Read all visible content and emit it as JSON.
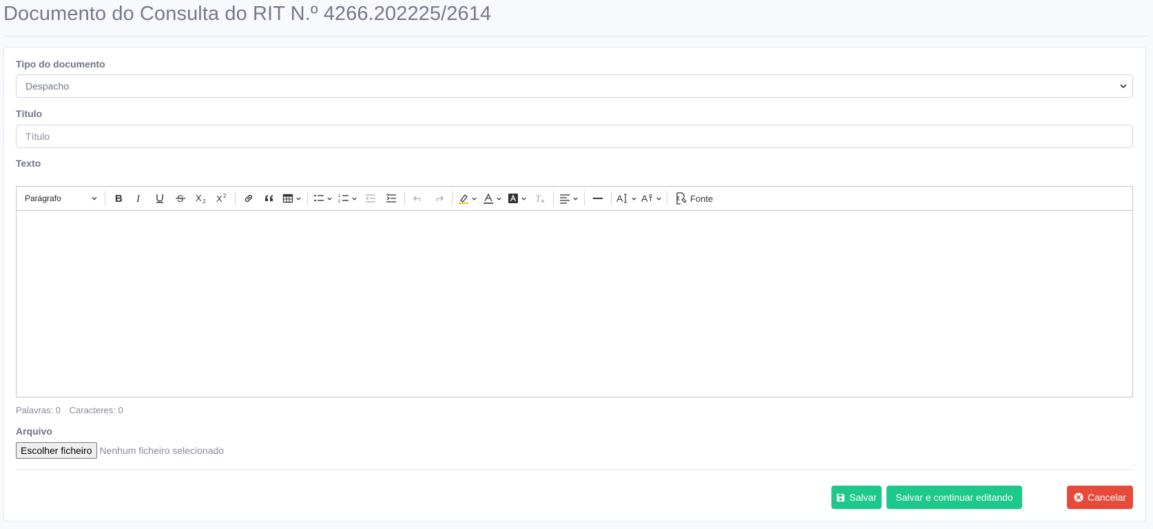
{
  "page": {
    "title": "Documento do Consulta do RIT N.º 4266.202225/2614"
  },
  "form": {
    "tipo_label": "Tipo do documento",
    "tipo_value": "Despacho",
    "titulo_label": "Título",
    "titulo_placeholder": "Título",
    "texto_label": "Texto",
    "arquivo_label": "Arquivo",
    "file_button": "Escolher ficheiro",
    "file_status": "Nenhum ficheiro selecionado"
  },
  "editor": {
    "heading_value": "Parágrafo",
    "source_label": "Fonte",
    "toolbar_icons": [
      "bold-icon",
      "italic-icon",
      "underline-icon",
      "strikethrough-icon",
      "subscript-icon",
      "superscript-icon",
      "link-icon",
      "blockquote-icon",
      "table-icon",
      "bulleted-list-icon",
      "numbered-list-icon",
      "outdent-icon",
      "indent-icon",
      "undo-icon",
      "redo-icon",
      "highlight-icon",
      "font-color-icon",
      "font-background-color-icon",
      "remove-format-icon",
      "alignment-icon",
      "horizontal-line-icon",
      "font-size-icon",
      "font-family-icon",
      "source-icon"
    ]
  },
  "wordcount": {
    "words": "Palavras: 0",
    "chars": "Caracteres: 0"
  },
  "actions": {
    "save": "Salvar",
    "save_continue": "Salvar e continuar editando",
    "cancel": "Cancelar"
  },
  "colors": {
    "success": "#1cc88a",
    "danger": "#e74a3b",
    "text_muted": "#6e7487"
  }
}
